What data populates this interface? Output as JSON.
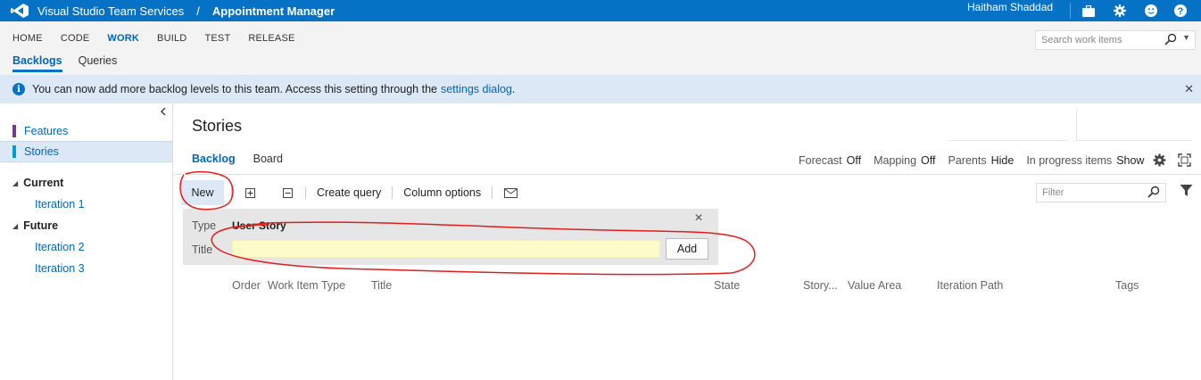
{
  "topbar": {
    "brand": "Visual Studio Team Services",
    "separator": "/",
    "project": "Appointment Manager",
    "user": "Haitham Shaddad",
    "icons": [
      "briefcase-icon",
      "gear-icon",
      "smiley-icon",
      "help-icon"
    ],
    "color": "#0672c6"
  },
  "hubnav": {
    "hubs": [
      "HOME",
      "CODE",
      "WORK",
      "BUILD",
      "TEST",
      "RELEASE"
    ],
    "active_hub": "WORK",
    "subhubs": [
      "Backlogs",
      "Queries"
    ],
    "active_subhub": "Backlogs",
    "search_placeholder": "Search work items"
  },
  "banner": {
    "message": "You can now add more backlog levels to this team. Access this setting through the",
    "link": "settings dialog",
    "period": "."
  },
  "sidebar": {
    "backlog_levels": [
      {
        "label": "Features",
        "color": "#773b93"
      },
      {
        "label": "Stories",
        "color": "#009ccc"
      }
    ],
    "selected": "Stories",
    "groups": [
      {
        "label": "Current",
        "iterations": [
          "Iteration 1"
        ]
      },
      {
        "label": "Future",
        "iterations": [
          "Iteration 2",
          "Iteration 3"
        ]
      }
    ]
  },
  "main": {
    "title": "Stories",
    "tabs": [
      "Backlog",
      "Board"
    ],
    "active_tab": "Backlog",
    "options": [
      {
        "key": "Forecast",
        "value": "Off"
      },
      {
        "key": "Mapping",
        "value": "Off"
      },
      {
        "key": "Parents",
        "value": "Hide"
      },
      {
        "key": "In progress items",
        "value": "Show"
      }
    ],
    "toolbar": {
      "new_label": "New",
      "create_query_label": "Create query",
      "column_options_label": "Column options",
      "filter_placeholder": "Filter"
    },
    "add_panel": {
      "type_label": "Type",
      "type_value": "User Story",
      "title_label": "Title",
      "title_value": "",
      "add_label": "Add"
    },
    "columns": [
      "Order",
      "Work Item Type",
      "Title",
      "State",
      "Story...",
      "Value Area",
      "Iteration Path",
      "Tags"
    ]
  }
}
